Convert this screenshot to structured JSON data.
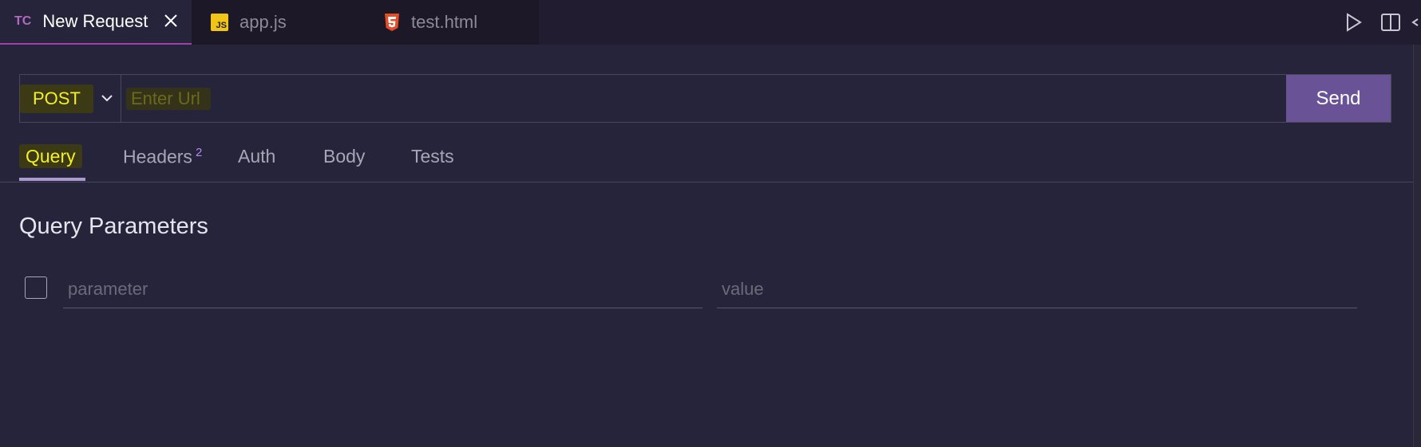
{
  "tabs": [
    {
      "label": "New Request",
      "icon": "tc-icon",
      "icon_text": "TC",
      "active": true
    },
    {
      "label": "app.js",
      "icon": "javascript-file-icon",
      "icon_text": "JS",
      "active": false
    },
    {
      "label": "test.html",
      "icon": "html5-file-icon",
      "active": false
    }
  ],
  "toolbar": {
    "run_icon": "play-icon",
    "split_icon": "split-editor-icon"
  },
  "request": {
    "method": "POST",
    "method_options_icon": "chevron-down-icon",
    "url_value": "",
    "url_placeholder": "Enter Url",
    "send_label": "Send"
  },
  "request_tabs": [
    {
      "label": "Query",
      "active": true
    },
    {
      "label": "Headers",
      "badge": "2"
    },
    {
      "label": "Auth"
    },
    {
      "label": "Body"
    },
    {
      "label": "Tests"
    }
  ],
  "query": {
    "title": "Query Parameters",
    "param_placeholder": "parameter",
    "value_placeholder": "value",
    "checked": false
  },
  "colors": {
    "background": "#26243a",
    "tabbar": "#221c30",
    "accent": "#6a5296",
    "highlight": "#f4ef26",
    "badge": "#b08be8"
  }
}
